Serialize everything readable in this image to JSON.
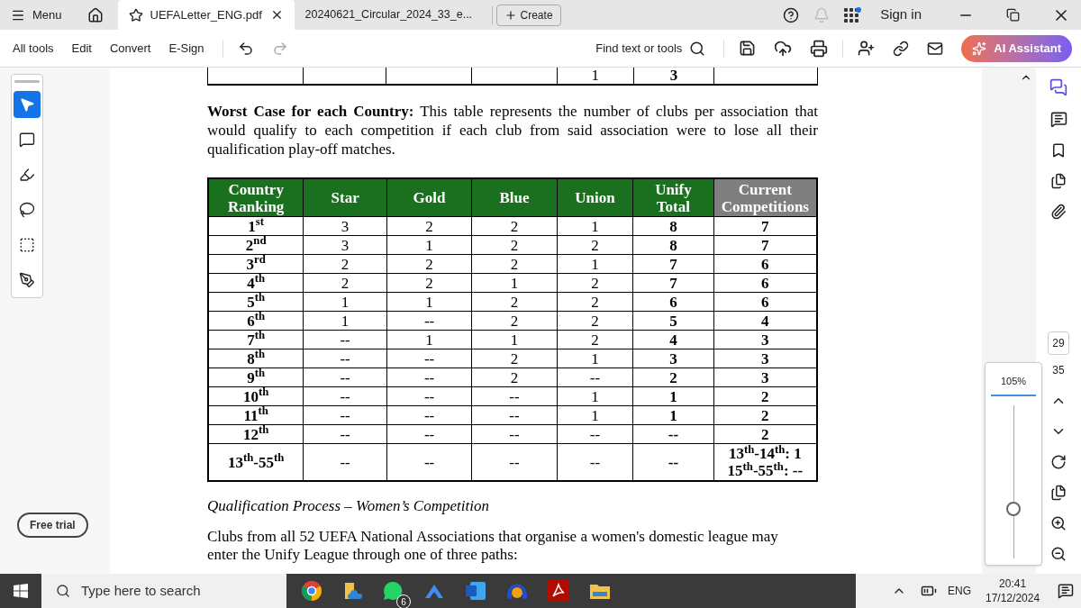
{
  "titlebar": {
    "menu": "Menu",
    "tabs": [
      {
        "label": "UEFALetter_ENG.pdf",
        "selected": true
      },
      {
        "label": "20240621_Circular_2024_33_e...",
        "selected": false
      }
    ],
    "create": "Create",
    "sign_in": "Sign in"
  },
  "toolbar": {
    "items": [
      "All tools",
      "Edit",
      "Convert",
      "E-Sign"
    ],
    "find": "Find text or tools",
    "ai": "AI Assistant"
  },
  "tools": [
    {
      "kind": "select",
      "selected": true
    },
    {
      "kind": "comment",
      "selected": false
    },
    {
      "kind": "highlight",
      "selected": false
    },
    {
      "kind": "draw",
      "selected": false
    },
    {
      "kind": "text",
      "selected": false
    },
    {
      "kind": "sign",
      "selected": false
    }
  ],
  "free_trial": "Free trial",
  "document": {
    "prev_row": {
      "union": "1",
      "unify_total": "3"
    },
    "paragraph": "**Worst Case for each Country:** This table represents the number of clubs per association that would qualify to each competition if each club from said association were to lose all their qualification play-off matches.",
    "table": {
      "columns": [
        {
          "lines": [
            "Country",
            "Ranking"
          ],
          "shaded": false
        },
        {
          "lines": [
            "Star"
          ],
          "shaded": false
        },
        {
          "lines": [
            "Gold"
          ],
          "shaded": false
        },
        {
          "lines": [
            "Blue"
          ],
          "shaded": false
        },
        {
          "lines": [
            "Union"
          ],
          "shaded": false
        },
        {
          "lines": [
            "Unify",
            "Total"
          ],
          "shaded": false
        },
        {
          "lines": [
            "Current",
            "Competitions"
          ],
          "shaded": true
        }
      ],
      "rows": [
        [
          "1$^{st}$",
          "3",
          "2",
          "2",
          "1",
          "8",
          "7"
        ],
        [
          "2$^{nd}$",
          "3",
          "1",
          "2",
          "2",
          "8",
          "7"
        ],
        [
          "3$^{rd}$",
          "2",
          "2",
          "2",
          "1",
          "7",
          "6"
        ],
        [
          "4$^{th}$",
          "2",
          "2",
          "1",
          "2",
          "7",
          "6"
        ],
        [
          "5$^{th}$",
          "1",
          "1",
          "2",
          "2",
          "6",
          "6"
        ],
        [
          "6$^{th}$",
          "1",
          "--",
          "2",
          "2",
          "5",
          "4"
        ],
        [
          "7$^{th}$",
          "--",
          "1",
          "1",
          "2",
          "4",
          "3"
        ],
        [
          "8$^{th}$",
          "--",
          "--",
          "2",
          "1",
          "3",
          "3"
        ],
        [
          "9$^{th}$",
          "--",
          "--",
          "2",
          "--",
          "2",
          "3"
        ],
        [
          "10$^{th}$",
          "--",
          "--",
          "--",
          "1",
          "1",
          "2"
        ],
        [
          "11$^{th}$",
          "--",
          "--",
          "--",
          "1",
          "1",
          "2"
        ],
        [
          "12$^{th}$",
          "--",
          "--",
          "--",
          "--",
          "--",
          "2"
        ],
        [
          "13$^{th}$-55$^{th}$",
          "--",
          "--",
          "--",
          "--",
          "--",
          [
            "13$^{th}$-14$^{th}$: 1",
            "15$^{th}$-55$^{th}$: --"
          ]
        ]
      ]
    },
    "heading": "Qualification Process – Women’s Competition",
    "body": [
      "Clubs from all 52 UEFA National Associations that organise a women's domestic league may",
      "enter the Unify League through one of three paths:"
    ]
  },
  "zoom": {
    "label": "105%",
    "level": 0.32
  },
  "pages": {
    "current": "29",
    "total": "35"
  },
  "taskbar": {
    "search_placeholder": "Type here to search",
    "whatsapp_badge": "6",
    "language": "ENG",
    "time": "20:41",
    "date": "17/12/2024"
  }
}
